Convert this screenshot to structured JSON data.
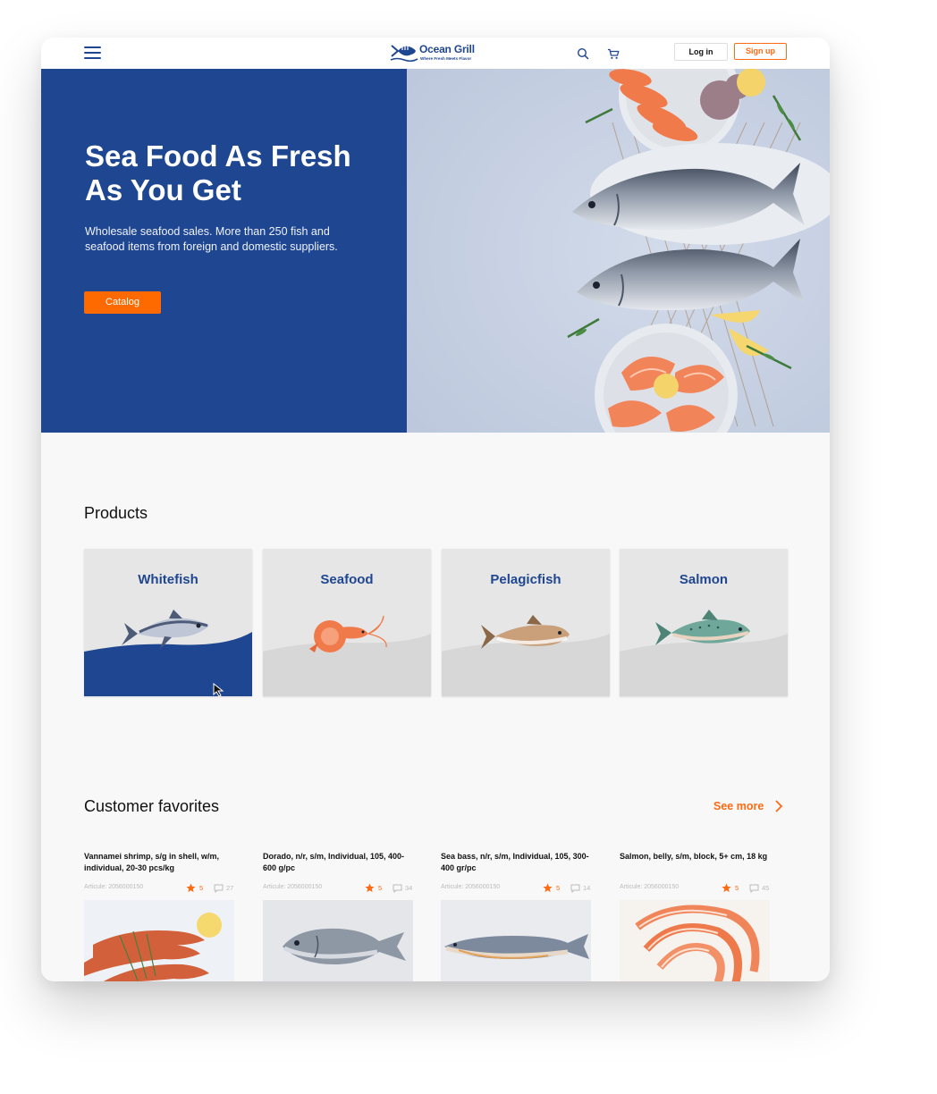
{
  "header": {
    "logo_name": "Ocean Grill",
    "logo_tagline": "Where Fresh Meets Flavor",
    "menu_icon": "hamburger-icon",
    "search_icon": "search-icon",
    "cart_icon": "cart-icon",
    "login_label": "Log in",
    "signup_label": "Sign up"
  },
  "hero": {
    "title": "Sea Food As Fresh As You Get",
    "subtitle": "Wholesale seafood sales. More than 250 fish and seafood items from foreign and domestic suppliers.",
    "cta_label": "Catalog",
    "image": "fish-on-plates-photo"
  },
  "products": {
    "title": "Products",
    "categories": [
      {
        "label": "Whitefish",
        "icon": "whitefish-icon",
        "state": "hover"
      },
      {
        "label": "Seafood",
        "icon": "shrimp-icon"
      },
      {
        "label": "Pelagicfish",
        "icon": "pelagicfish-icon"
      },
      {
        "label": "Salmon",
        "icon": "salmon-icon"
      }
    ]
  },
  "favorites": {
    "title": "Customer favorites",
    "see_more_label": "See more",
    "items": [
      {
        "name": "Vannamei shrimp, s/g in shell, w/m, individual, 20-30 pcs/kg",
        "article": "Articule: 2056000150",
        "rating": "5",
        "comments": "27",
        "image": "shrimp-photo"
      },
      {
        "name": "Dorado, n/r, s/m, Individual, 105, 400-600 g/pc",
        "article": "Articule: 2056000150",
        "rating": "5",
        "comments": "34",
        "image": "dorado-photo"
      },
      {
        "name": "Sea bass, n/r, s/m, Individual, 105, 300-400 gr/pc",
        "article": "Articule: 2056000150",
        "rating": "5",
        "comments": "14",
        "image": "sea-bass-photo"
      },
      {
        "name": "Salmon, belly, s/m, block, 5+ cm, 18 kg",
        "article": "Articule: 2056000150",
        "rating": "5",
        "comments": "45",
        "image": "salmon-belly-photo"
      }
    ]
  },
  "colors": {
    "brand_blue": "#1f4690",
    "accent_orange": "#ff6a13",
    "page_bg": "#f8f8f8"
  }
}
